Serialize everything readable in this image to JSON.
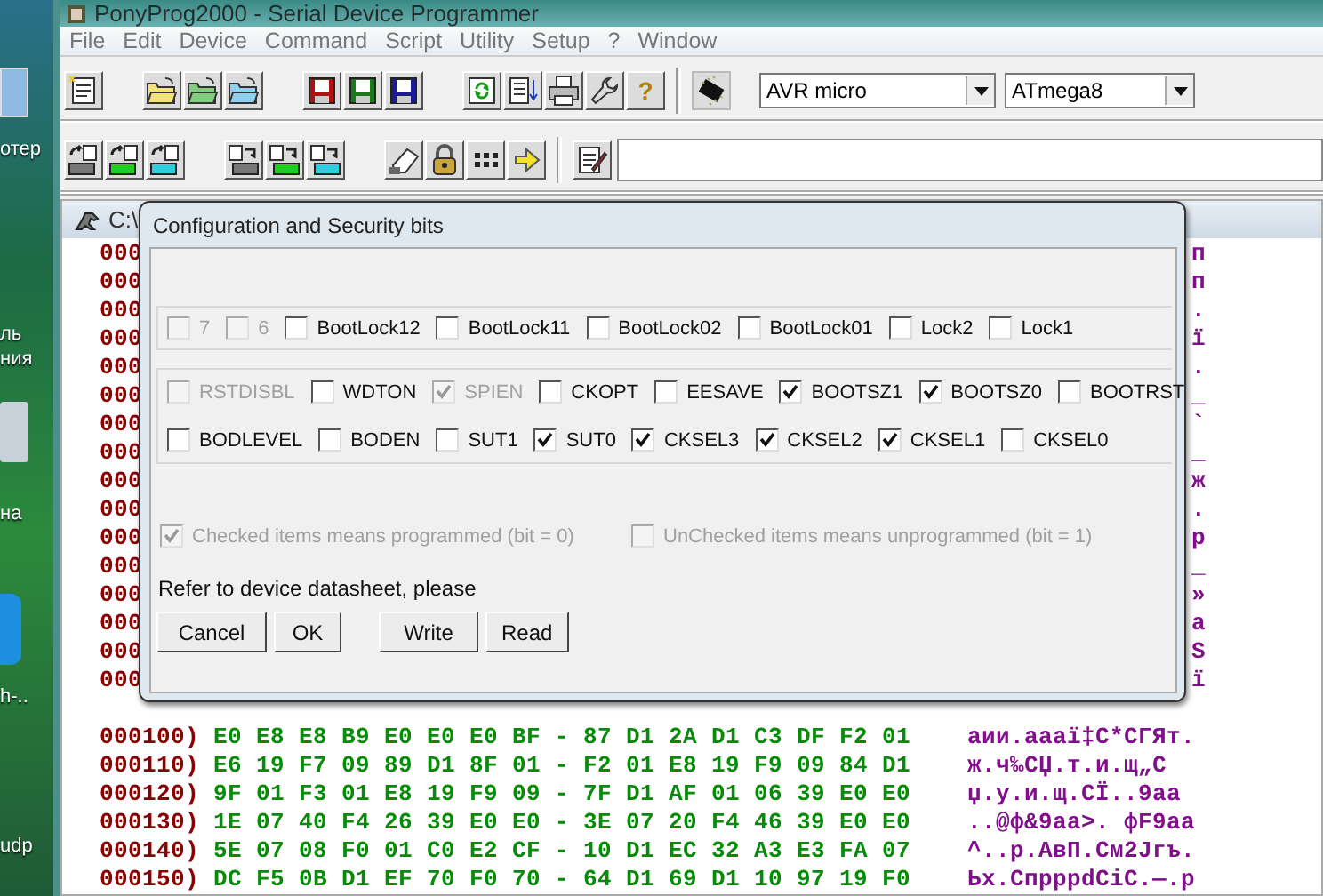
{
  "desktop_labels": [
    "отер",
    "ль",
    "ния",
    "на",
    "h-..",
    "udp"
  ],
  "window": {
    "title": "PonyProg2000 - Serial Device Programmer"
  },
  "menu": [
    "File",
    "Edit",
    "Device",
    "Command",
    "Script",
    "Utility",
    "Setup",
    "?",
    "Window"
  ],
  "toolbar": {
    "help_label": "?",
    "device_family": "AVR micro",
    "device": "ATmega8"
  },
  "child_window": {
    "title": "C:\\"
  },
  "hidden_rows": [
    {
      "address": "000",
      "ascii": "п"
    },
    {
      "address": "000",
      "ascii": "п"
    },
    {
      "address": "000",
      "ascii": "."
    },
    {
      "address": "000",
      "ascii": "ї"
    },
    {
      "address": "000",
      "ascii": "."
    },
    {
      "address": "000",
      "ascii": "_"
    },
    {
      "address": "000",
      "ascii": "`"
    },
    {
      "address": "000",
      "ascii": "_"
    },
    {
      "address": "000",
      "ascii": "ж"
    },
    {
      "address": "000",
      "ascii": "."
    },
    {
      "address": "000",
      "ascii": "р"
    },
    {
      "address": "000",
      "ascii": "_"
    },
    {
      "address": "000",
      "ascii": "»"
    },
    {
      "address": "000",
      "ascii": "a"
    },
    {
      "address": "000",
      "ascii": "S"
    },
    {
      "address": "000",
      "ascii": "ї"
    }
  ],
  "hex_rows": [
    {
      "address": "000100)",
      "bytes": "E0 E8 E8 B9 E0 E0 E0 BF - 87 D1 2A D1 C3 DF F2 01",
      "ascii": "аии.аааї‡С*СГЯт."
    },
    {
      "address": "000110)",
      "bytes": "E6 19 F7 09 89 D1 8F 01 - F2 01 E8 19 F9 09 84 D1",
      "ascii": "ж.ч‰СЏ.т.и.щ„С"
    },
    {
      "address": "000120)",
      "bytes": "9F 01 F3 01 E8 19 F9 09 - 7F D1 AF 01 06 39 E0 E0",
      "ascii": "џ.у.и.щ.СЇ..9аа"
    },
    {
      "address": "000130)",
      "bytes": "1E 07 40 F4 26 39 E0 E0 - 3E 07 20 F4 46 39 E0 E0",
      "ascii": "..@ф&9аа>. фF9аа"
    },
    {
      "address": "000140)",
      "bytes": "5E 07 08 F0 01 C0 E2 CF - 10 D1 EC 32 A3 E3 FA 07",
      "ascii": "^..р.АвП.См2Јгъ."
    },
    {
      "address": "000150)",
      "bytes": "DC F5 0B D1 EF 70 F0 70 - 64 D1 69 D1 10 97 19 F0",
      "ascii": "Ьх.СпрррdСiС.—.р"
    }
  ],
  "dialog": {
    "title": "Configuration and Security bits",
    "groups": [
      {
        "rows": [
          [
            {
              "label": "7",
              "checked": false,
              "disabled": true
            },
            {
              "label": "6",
              "checked": false,
              "disabled": true
            },
            {
              "label": "BootLock12",
              "checked": false,
              "disabled": false
            },
            {
              "label": "BootLock11",
              "checked": false,
              "disabled": false
            },
            {
              "label": "BootLock02",
              "checked": false,
              "disabled": false
            },
            {
              "label": "BootLock01",
              "checked": false,
              "disabled": false
            },
            {
              "label": "Lock2",
              "checked": false,
              "disabled": false
            },
            {
              "label": "Lock1",
              "checked": false,
              "disabled": false
            }
          ]
        ]
      },
      {
        "rows": [
          [
            {
              "label": "RSTDISBL",
              "checked": false,
              "disabled": true
            },
            {
              "label": "WDTON",
              "checked": false,
              "disabled": false
            },
            {
              "label": "SPIEN",
              "checked": true,
              "disabled": true
            },
            {
              "label": "CKOPT",
              "checked": false,
              "disabled": false
            },
            {
              "label": "EESAVE",
              "checked": false,
              "disabled": false
            },
            {
              "label": "BOOTSZ1",
              "checked": true,
              "disabled": false
            },
            {
              "label": "BOOTSZ0",
              "checked": true,
              "disabled": false
            },
            {
              "label": "BOOTRST",
              "checked": false,
              "disabled": false
            }
          ],
          [
            {
              "label": "BODLEVEL",
              "checked": false,
              "disabled": false
            },
            {
              "label": "BODEN",
              "checked": false,
              "disabled": false
            },
            {
              "label": "SUT1",
              "checked": false,
              "disabled": false
            },
            {
              "label": "SUT0",
              "checked": true,
              "disabled": false
            },
            {
              "label": "CKSEL3",
              "checked": true,
              "disabled": false
            },
            {
              "label": "CKSEL2",
              "checked": true,
              "disabled": false
            },
            {
              "label": "CKSEL1",
              "checked": true,
              "disabled": false
            },
            {
              "label": "CKSEL0",
              "checked": false,
              "disabled": false
            }
          ]
        ]
      }
    ],
    "options": [
      {
        "label": "Checked items means programmed (bit = 0)",
        "checked": true,
        "disabled": true
      },
      {
        "label": "UnChecked items means unprogrammed (bit = 1)",
        "checked": false,
        "disabled": true
      }
    ],
    "note": "Refer to device datasheet, please",
    "buttons": [
      "Cancel",
      "OK",
      "Write",
      "Read"
    ]
  }
}
